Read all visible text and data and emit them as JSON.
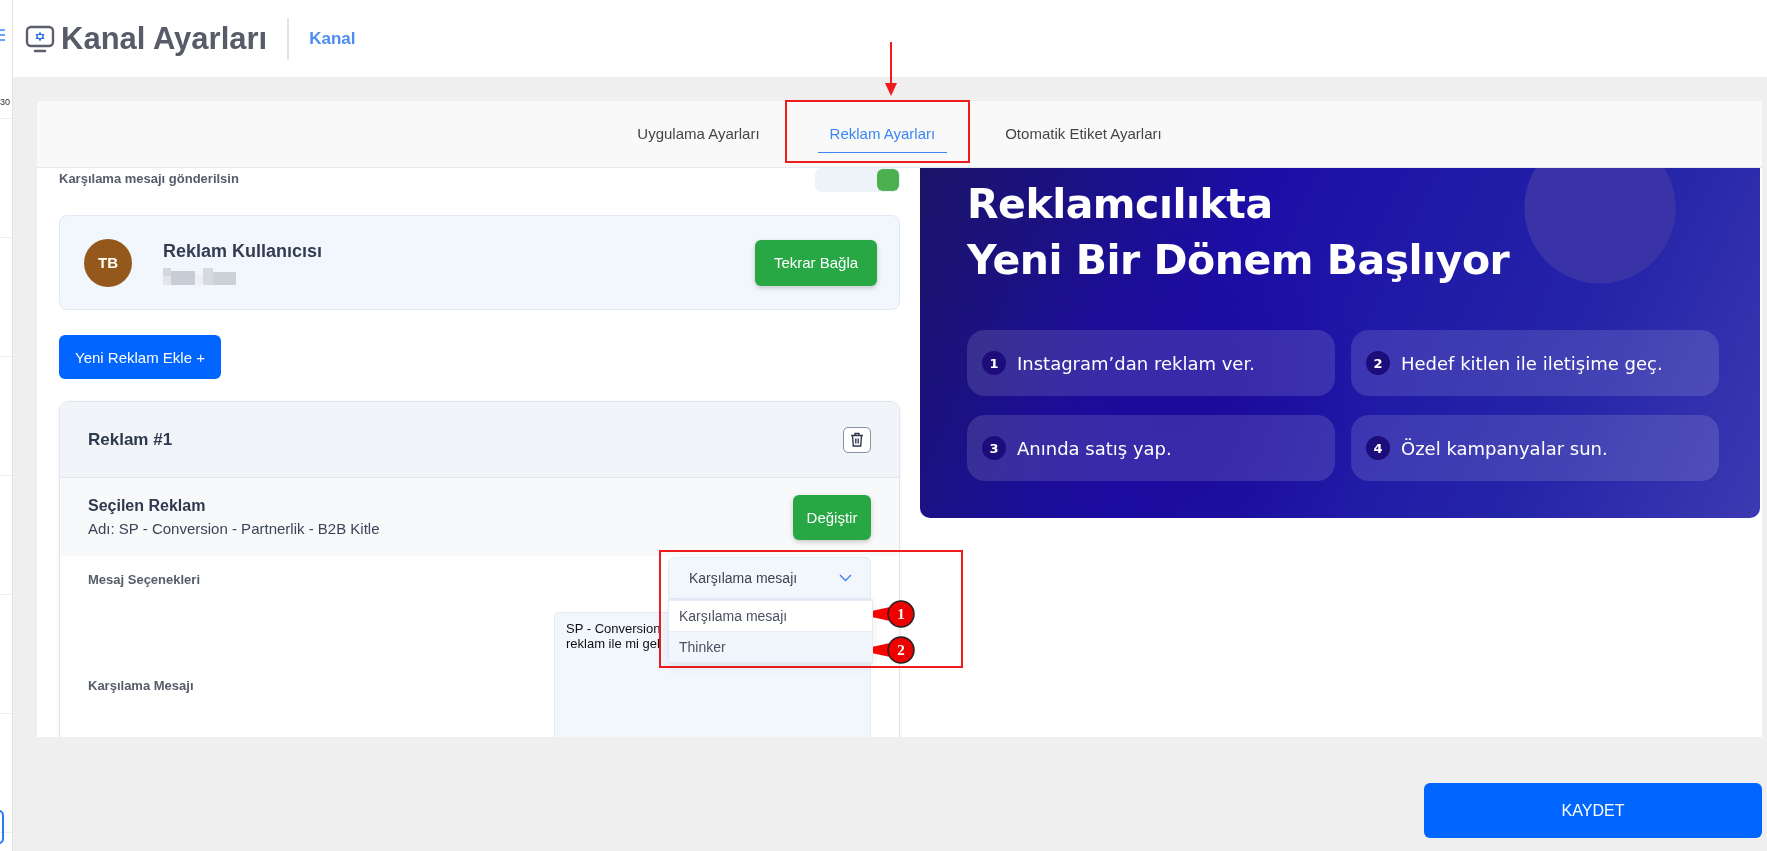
{
  "sidebar": {
    "text": "30"
  },
  "header": {
    "title": "Kanal Ayarları",
    "breadcrumb": "Kanal"
  },
  "tabs": [
    {
      "label": "Uygulama Ayarları",
      "selected": false
    },
    {
      "label": "Reklam Ayarları",
      "selected": true
    },
    {
      "label": "Otomatik Etiket Ayarları",
      "selected": false
    }
  ],
  "welcome_toggle": {
    "label": "Karşılama mesajı gönderilsin",
    "on": true
  },
  "ad_account": {
    "avatar": "TB",
    "name": "Reklam Kullanıcısı",
    "button": "Tekrar Bağla"
  },
  "add_button": "Yeni Reklam Ekle +",
  "ad": {
    "title": "Reklam #1",
    "selected_label": "Seçilen Reklam",
    "selected_name": "Adı: SP - Conversion - Partnerlik - B2B Kitle",
    "change_button": "Değiştir",
    "message_options": {
      "label": "Mesaj Seçenekleri",
      "value": "Karşılama mesajı",
      "expanded": true,
      "options": [
        {
          "label": "Karşılama mesajı",
          "highlighted": false
        },
        {
          "label": "Thinker",
          "highlighted": true
        }
      ]
    },
    "welcome_message": {
      "label": "Karşılama Mesajı",
      "lines": [
        "SP - Conversion",
        "reklam ile mi gel"
      ]
    }
  },
  "banner": {
    "title_lines": [
      "Reklamcılıkta",
      "Yeni Bir Dönem Başlıyor"
    ],
    "items": [
      {
        "number": "1",
        "text": "Instagram’dan reklam ver."
      },
      {
        "number": "2",
        "text": "Hedef kitlen ile iletişime geç."
      },
      {
        "number": "3",
        "text": "Anında satış yap."
      },
      {
        "number": "4",
        "text": "Özel kampanyalar sun."
      }
    ]
  },
  "save_button": "KAYDET",
  "annotations": {
    "markers": [
      "1",
      "2"
    ]
  }
}
